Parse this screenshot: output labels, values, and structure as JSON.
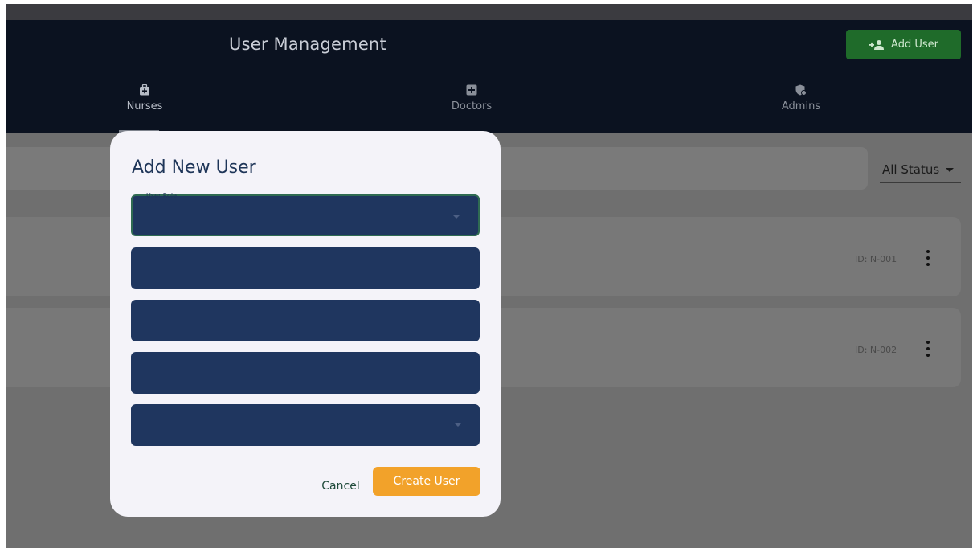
{
  "header": {
    "title": "User Management",
    "add_user_label": "Add User"
  },
  "tabs": [
    {
      "label": "Nurses",
      "icon": "medical-bag-icon",
      "active": true
    },
    {
      "label": "Doctors",
      "icon": "medical-cross-icon",
      "active": false
    },
    {
      "label": "Admins",
      "icon": "admin-shield-icon",
      "active": false
    }
  ],
  "filters": {
    "search_placeholder": "",
    "status_value": "All Status"
  },
  "list": {
    "items": [
      {
        "id": "ID: N-001"
      },
      {
        "id": "ID: N-002"
      }
    ]
  },
  "dialog": {
    "title": "Add New User",
    "fields": [
      {
        "label": "User Role",
        "value": "",
        "type": "select"
      },
      {
        "label": "",
        "value": "",
        "type": "text"
      },
      {
        "label": "",
        "value": "",
        "type": "text"
      },
      {
        "label": "",
        "value": "",
        "type": "text"
      },
      {
        "label": "",
        "value": "",
        "type": "select"
      }
    ],
    "cancel_label": "Cancel",
    "create_label": "Create User"
  },
  "colors": {
    "appbar": "#0b1220",
    "add_button": "#1f6b2a",
    "field_bg": "#1f365f",
    "create_button": "#f2a22a",
    "dialog_bg": "#f4f3f9"
  }
}
